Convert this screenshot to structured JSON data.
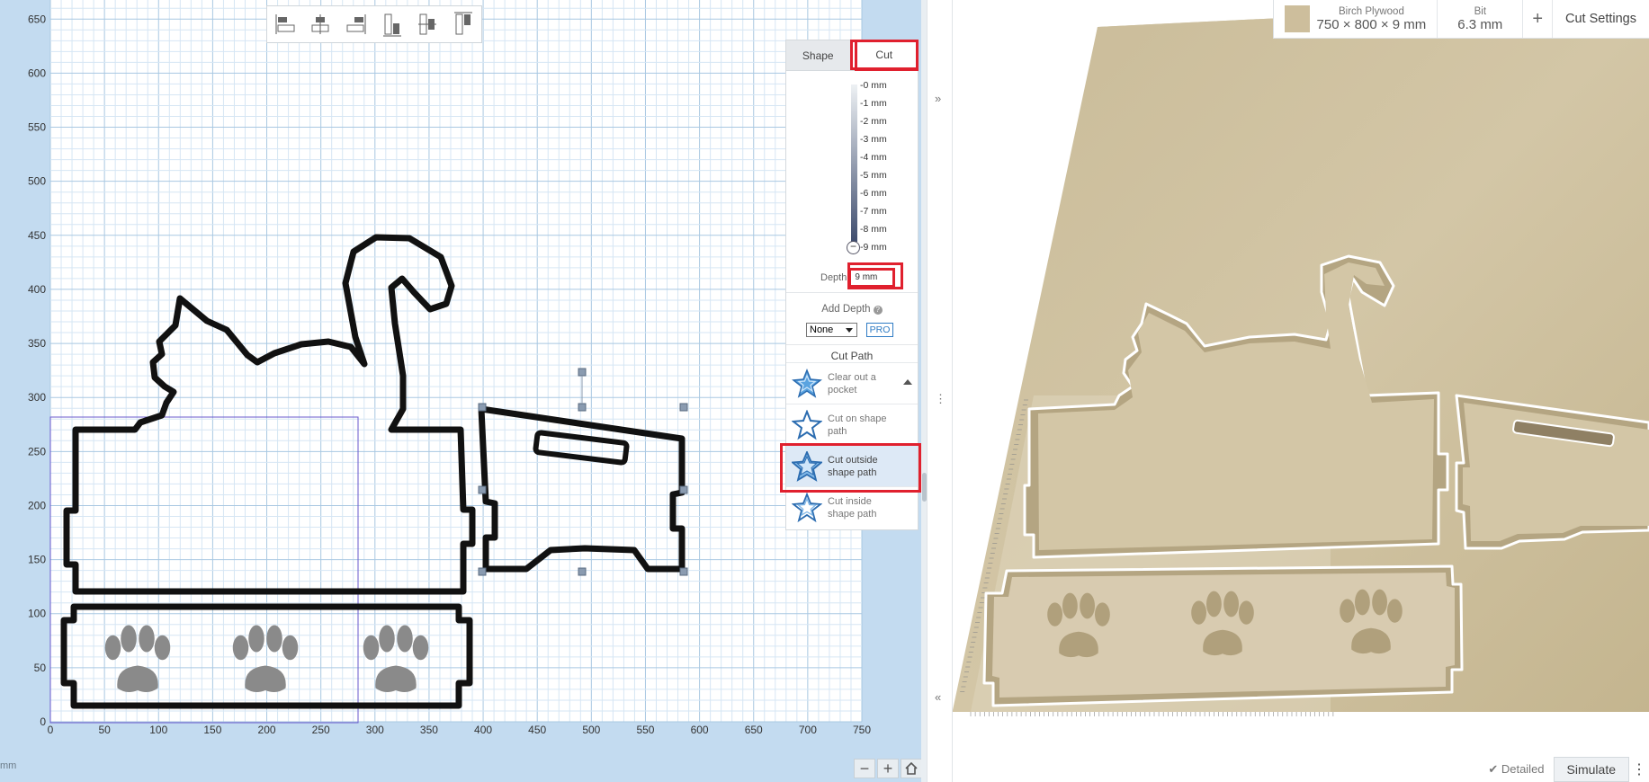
{
  "canvas": {
    "x_ticks": [
      "0",
      "50",
      "100",
      "150",
      "200",
      "250",
      "300",
      "350",
      "400",
      "450",
      "500",
      "550",
      "600",
      "650",
      "700",
      "750"
    ],
    "y_ticks": [
      "650",
      "600",
      "550",
      "500",
      "450",
      "400",
      "350",
      "300",
      "250",
      "200",
      "150",
      "100",
      "50",
      "0"
    ],
    "units": "mm",
    "colors": {
      "background": "#c3dbf0",
      "work_area": "#ffffff",
      "grid_minor": "#d6e6f4",
      "grid_major": "#a9c8e2",
      "outline": "#111111",
      "paw": "#8a8a8a"
    }
  },
  "align_toolbar": {
    "icons": [
      "align-left-icon",
      "align-center-horizontal-icon",
      "align-right-icon",
      "align-bottom-icon",
      "align-center-vertical-icon",
      "align-top-icon"
    ]
  },
  "zoom": {
    "minus": "−",
    "plus": "+",
    "home_icon": "home-icon"
  },
  "panel": {
    "tabs": [
      {
        "label": "Shape",
        "active": false
      },
      {
        "label": "Cut",
        "active": true
      }
    ],
    "depth_ticks": [
      "-0 mm",
      "-1 mm",
      "-2 mm",
      "-3 mm",
      "-4 mm",
      "-5 mm",
      "-6 mm",
      "-7 mm",
      "-8 mm",
      "-9 mm"
    ],
    "depth_label": "Depth",
    "depth_value": "9 mm",
    "add_depth_label": "Add Depth",
    "add_depth_help_icon": "help-icon",
    "add_depth_select": "None",
    "pro_badge": "PRO",
    "cut_path_title": "Cut Path",
    "cut_options": [
      {
        "label": "Clear out a pocket",
        "icon": "pocket-star-icon",
        "selected": false
      },
      {
        "label": "Cut on shape path",
        "icon": "on-path-star-icon",
        "selected": false
      },
      {
        "label": "Cut outside shape path",
        "icon": "outside-path-star-icon",
        "selected": true
      },
      {
        "label": "Cut inside shape path",
        "icon": "inside-path-star-icon",
        "selected": false
      }
    ]
  },
  "collapse": {
    "expand_icon": "»",
    "more_icon": "⋮",
    "collapse_icon": "«"
  },
  "preview": {
    "material_name": "Birch Plywood",
    "material_dims": "750 × 800 × 9 mm",
    "bit_label": "Bit",
    "bit_value": "6.3 mm",
    "add_icon": "+",
    "cut_settings": "Cut Settings",
    "detailed_label": "✔ Detailed",
    "simulate": "Simulate",
    "menu_icon": "⋮",
    "colors": {
      "wood": "#cdbe9c",
      "wood_light": "#e6dcc6",
      "cut_edge": "#ffffff"
    }
  }
}
